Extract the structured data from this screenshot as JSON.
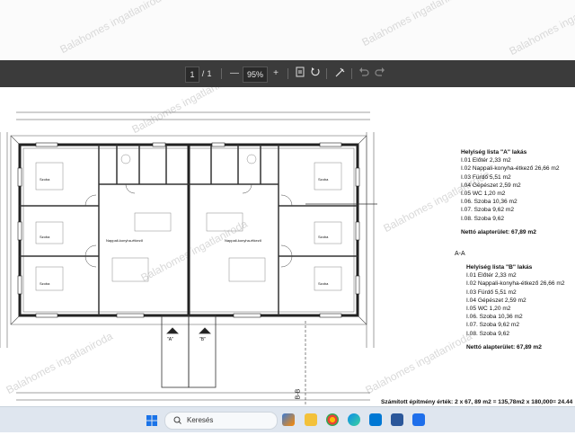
{
  "watermark": "Balahomes ingatlaniroda",
  "toolbar": {
    "page_current": "1",
    "page_separator": "/",
    "page_total": "1",
    "zoom_minus": "—",
    "zoom": "95%",
    "zoom_plus": "+"
  },
  "legend_a": {
    "title": "Helyiség lista \"A\" lakás",
    "items": [
      "I.01 Előtér 2,33 m2",
      "I.02 Nappali-konyha-étkező 26,66 m2",
      "I.03 Fürdő 5,51 m2",
      "I.04 Gépészet 2,59 m2",
      "I.05 WC 1,20 m2",
      "I.06. Szoba 10,36 m2",
      "I.07. Szoba 9,62 m2",
      "I.08. Szoba 9,62"
    ],
    "total": "Nettó alapterület: 67,89 m2"
  },
  "legend_b": {
    "title": "Helyiség lista \"B\" lakás",
    "items": [
      "I.01 Előtér 2,33 m2",
      "I.02 Nappali-konyha-étkező 26,66 m2",
      "I.03 Fürdő 5,51 m2",
      "I.04 Gépészet 2,59 m2",
      "I.05 WC 1,20 m2",
      "I.06. Szoba 10,36 m2",
      "I.07. Szoba 9,62 m2",
      "I.08. Szoba 9,62"
    ],
    "total": "Nettó alapterület: 67,89 m2"
  },
  "section_label": "A-A",
  "section_label_b": "B-B",
  "unit_a": "\"A\"",
  "unit_b": "\"B\"",
  "room_labels": {
    "szoba": "Szoba",
    "nappali": "Nappali-konyha-étkező"
  },
  "footer": "Számított építmény érték: 2 x 67, 89 m2 = 135,78m2 x 180,000= 24.44",
  "taskbar": {
    "search_label": "Keresés"
  }
}
